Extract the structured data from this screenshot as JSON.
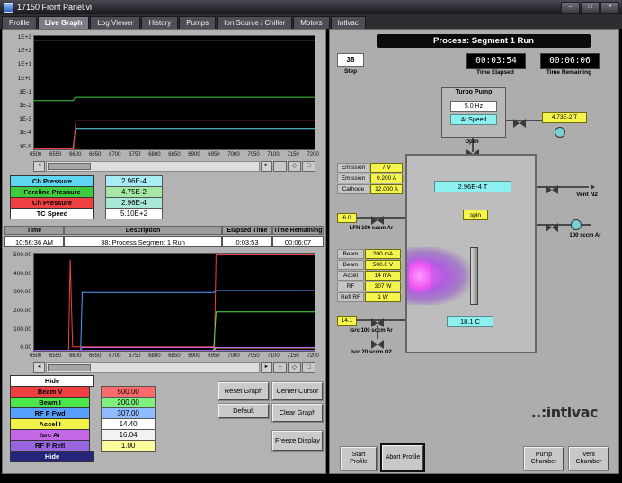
{
  "window": {
    "title": "17150 Front Panel.vi",
    "controls": {
      "minimize": "–",
      "maximize": "□",
      "close": "×"
    }
  },
  "icons": {
    "scroll_left": "◄",
    "scroll_right": "►",
    "tool_zoom": "+",
    "tool_pan": "◇",
    "tool_cursor": "□"
  },
  "tabs": {
    "items": [
      "Profile",
      "Live Graph",
      "Log Viewer",
      "History",
      "Pumps",
      "Ion Source / Chiller",
      "Motors",
      "Intlvac"
    ],
    "active": "Live Graph"
  },
  "pressure_graph": {
    "y_ticks": [
      "1E+3",
      "1E+2",
      "1E+1",
      "1E+0",
      "1E-1",
      "1E-2",
      "1E-3",
      "1E-4",
      "1E-5"
    ],
    "x_ticks": [
      "6500",
      "6550",
      "6600",
      "6650",
      "6700",
      "6750",
      "6800",
      "6850",
      "6900",
      "6950",
      "7000",
      "7050",
      "7100",
      "7150",
      "7200"
    ],
    "legend": [
      {
        "label": "Ch Pressure",
        "value": "2.96E-4",
        "color": "#5fd7f2",
        "value_bg": "#a8ecf5"
      },
      {
        "label": "Foreline Pressure",
        "value": "4.75E-2",
        "color": "#3ecc3e",
        "value_bg": "#a5e8a5"
      },
      {
        "label": "Ch Pressure",
        "value": "2.96E-4",
        "color": "#ee4040",
        "value_bg": "#a8e8d8"
      },
      {
        "label": "TC Speed",
        "value": "5.10E+2",
        "color": "#ffffff",
        "value_bg": "#ffffff"
      }
    ]
  },
  "status_row": {
    "headers": [
      "Time",
      "Description",
      "Elapsed Time",
      "Time Remaining"
    ],
    "time": "10:56:36 AM",
    "description": "38: Process Segment 1 Run",
    "elapsed": "0:03:53",
    "remaining": "00:06:07"
  },
  "level_graph": {
    "y_ticks": [
      "500.00",
      "400.00",
      "300.00",
      "200.00",
      "100.00",
      "0.00"
    ],
    "x_ticks": [
      "6500",
      "6550",
      "6600",
      "6650",
      "6700",
      "6750",
      "6800",
      "6850",
      "6900",
      "6950",
      "7000",
      "7050",
      "7100",
      "7150",
      "7200"
    ],
    "legend": [
      {
        "label": "Hide",
        "value": "",
        "color": "#ffffff",
        "value_bg": ""
      },
      {
        "label": "Beam V",
        "value": "500.00",
        "color": "#ee4040",
        "value_bg": "#ff6b6b"
      },
      {
        "label": "Beam I",
        "value": "200.00",
        "color": "#4ce64c",
        "value_bg": "#7df07d"
      },
      {
        "label": "RF P Fwd",
        "value": "307.00",
        "color": "#569fff",
        "value_bg": "#8fbcff"
      },
      {
        "label": "Accel I",
        "value": "14.40",
        "color": "#f2f24a",
        "value_bg": "#ffffff"
      },
      {
        "label": "Isrc Ar",
        "value": "16.04",
        "color": "#c468e8",
        "value_bg": "#f2f2f2"
      },
      {
        "label": "RF P Refl",
        "value": "1.00",
        "color": "#9a66e0",
        "value_bg": "#fcfc9a"
      },
      {
        "label": "Hide",
        "value": "",
        "color": "#24247a",
        "value_bg": ""
      }
    ],
    "buttons": {
      "reset": "Reset Graph",
      "center": "Center Cursor",
      "default": "Default",
      "clear": "Clear Graph",
      "freeze": "Freeze Display"
    }
  },
  "process": {
    "title": "Process: Segment 1 Run",
    "step": {
      "value": "38",
      "label": "Step"
    },
    "elapsed": {
      "value": "00:03:54",
      "label": "Time Elapsed"
    },
    "remaining": {
      "value": "00:06:06",
      "label": "Time Remaining"
    },
    "turbo": {
      "title": "Turbo Pump",
      "freq": "5.0 Hz",
      "status": "At Speed",
      "valve_state": "Open",
      "foreline_pressure": "4.73E-2 T"
    },
    "emission_rows": [
      {
        "label": "Emission",
        "value": "7 V"
      },
      {
        "label": "Emission",
        "value": "0.200 A"
      },
      {
        "label": "Cathode",
        "value": "12.000 A"
      }
    ],
    "lfn": {
      "value": "6.0",
      "label": "LFN 100 sccm Ar"
    },
    "beam_rows": [
      {
        "label": "Beam",
        "value": "200 mA"
      },
      {
        "label": "Beam",
        "value": "500.0 V"
      },
      {
        "label": "Accel",
        "value": "14 mA"
      },
      {
        "label": "RF",
        "value": "307 W"
      },
      {
        "label": "Refl RF",
        "value": "1 W"
      }
    ],
    "isrc": {
      "value": "14.1",
      "label": "Isrc 100 sccm Ar"
    },
    "isrc_o2_label": "Isrc 20 sccm O2",
    "chamber": {
      "pressure": "2.96E-4 T",
      "spin_label": "spin",
      "temp": "18.1 C"
    },
    "vent_n2_label": "Vent N2",
    "ar_line_label": "100 sccm Ar",
    "logo": "..:intlvac",
    "buttons": {
      "start": "Start Profile",
      "abort": "Abort Profile",
      "pump": "Pump Chamber",
      "vent": "Vent Chamber"
    }
  },
  "chart_data": [
    {
      "type": "line",
      "title": "Pressure / speed log graph",
      "scale": "log",
      "x_range": [
        6500,
        7200
      ],
      "y_range_log10": [
        -5,
        3
      ],
      "grid": false,
      "series": [
        {
          "name": "TC Speed",
          "color": "#ffffff",
          "points": [
            [
              6500,
              510
            ],
            [
              7200,
              510
            ]
          ]
        },
        {
          "name": "Foreline Pressure",
          "color": "#3ecc3e",
          "points": [
            [
              6500,
              0.028
            ],
            [
              6597,
              0.028
            ],
            [
              6603,
              0.0475
            ],
            [
              7200,
              0.0475
            ]
          ]
        },
        {
          "name": "Ch Pressure CC",
          "color": "#5fd7f2",
          "points": [
            [
              6500,
              1.2e-05
            ],
            [
              6597,
              1.2e-05
            ],
            [
              6603,
              0.000296
            ],
            [
              7200,
              0.000296
            ]
          ]
        },
        {
          "name": "Ch Pressure",
          "color": "#ee4040",
          "points": [
            [
              6500,
              1e-05
            ],
            [
              6598,
              1e-05
            ],
            [
              6604,
              0.00105
            ],
            [
              7200,
              0.00105
            ]
          ]
        }
      ]
    },
    {
      "type": "line",
      "title": "Process levels graph",
      "scale": "linear",
      "x_range": [
        6500,
        7200
      ],
      "y_range": [
        0,
        500
      ],
      "grid": false,
      "series": [
        {
          "name": "Beam V",
          "color": "#ee4040",
          "points": [
            [
              6500,
              0
            ],
            [
              6586,
              0
            ],
            [
              6590,
              470
            ],
            [
              6596,
              20
            ],
            [
              6950,
              20
            ],
            [
              6954,
              500
            ],
            [
              7200,
              500
            ]
          ]
        },
        {
          "name": "RF P Fwd",
          "color": "#569fff",
          "points": [
            [
              6500,
              0
            ],
            [
              6616,
              0
            ],
            [
              6620,
              300
            ],
            [
              6948,
              300
            ],
            [
              6954,
              310
            ],
            [
              7200,
              310
            ]
          ]
        },
        {
          "name": "Beam I",
          "color": "#4ce64c",
          "points": [
            [
              6500,
              0
            ],
            [
              6948,
              0
            ],
            [
              6954,
              200
            ],
            [
              7200,
              200
            ]
          ]
        },
        {
          "name": "Accel I",
          "color": "#f2f24a",
          "points": [
            [
              6500,
              0
            ],
            [
              6948,
              0
            ],
            [
              6954,
              14.4
            ],
            [
              7200,
              14.4
            ]
          ]
        },
        {
          "name": "Isrc Ar",
          "color": "#c468e8",
          "points": [
            [
              6500,
              0
            ],
            [
              6616,
              0
            ],
            [
              6620,
              16
            ],
            [
              7200,
              16
            ]
          ]
        },
        {
          "name": "RF P Refl",
          "color": "#9a66e0",
          "points": [
            [
              6500,
              1
            ],
            [
              7200,
              1
            ]
          ]
        }
      ]
    }
  ]
}
